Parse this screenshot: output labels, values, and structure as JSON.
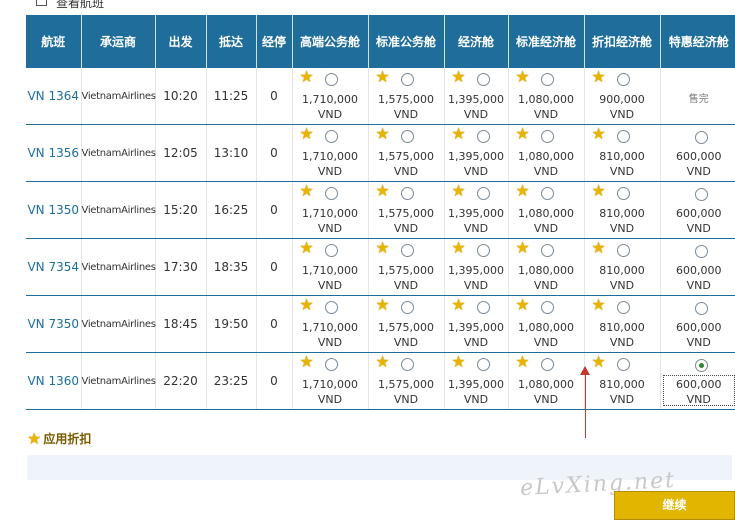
{
  "top_strip": {
    "label": "查看航班"
  },
  "columns": [
    "航班",
    "承运商",
    "出发",
    "抵达",
    "经停",
    "高端公务舱",
    "标准公务舱",
    "经济舱",
    "标准经济舱",
    "折扣经济舱",
    "特惠经济舱"
  ],
  "currency": "VND",
  "flights": [
    {
      "flight": "VN 1364",
      "carrier": "VietnamAirlines",
      "depart": "10:20",
      "arrive": "11:25",
      "stops": "0",
      "fares": [
        {
          "price": "1,710,000",
          "star": true
        },
        {
          "price": "1,575,000",
          "star": true
        },
        {
          "price": "1,395,000",
          "star": true
        },
        {
          "price": "1,080,000",
          "star": true
        },
        {
          "price": "900,000",
          "star": true
        },
        {
          "soldout": "售完"
        }
      ]
    },
    {
      "flight": "VN 1356",
      "carrier": "VietnamAirlines",
      "depart": "12:05",
      "arrive": "13:10",
      "stops": "0",
      "fares": [
        {
          "price": "1,710,000",
          "star": true
        },
        {
          "price": "1,575,000",
          "star": true
        },
        {
          "price": "1,395,000",
          "star": true
        },
        {
          "price": "1,080,000",
          "star": true
        },
        {
          "price": "810,000",
          "star": true
        },
        {
          "price": "600,000",
          "star": false
        }
      ]
    },
    {
      "flight": "VN 1350",
      "carrier": "VietnamAirlines",
      "depart": "15:20",
      "arrive": "16:25",
      "stops": "0",
      "fares": [
        {
          "price": "1,710,000",
          "star": true
        },
        {
          "price": "1,575,000",
          "star": true
        },
        {
          "price": "1,395,000",
          "star": true
        },
        {
          "price": "1,080,000",
          "star": true
        },
        {
          "price": "810,000",
          "star": true
        },
        {
          "price": "600,000",
          "star": false
        }
      ]
    },
    {
      "flight": "VN 7354",
      "carrier": "VietnamAirlines",
      "depart": "17:30",
      "arrive": "18:35",
      "stops": "0",
      "fares": [
        {
          "price": "1,710,000",
          "star": true
        },
        {
          "price": "1,575,000",
          "star": true
        },
        {
          "price": "1,395,000",
          "star": true
        },
        {
          "price": "1,080,000",
          "star": true
        },
        {
          "price": "810,000",
          "star": true
        },
        {
          "price": "600,000",
          "star": false
        }
      ]
    },
    {
      "flight": "VN 7350",
      "carrier": "VietnamAirlines",
      "depart": "18:45",
      "arrive": "19:50",
      "stops": "0",
      "fares": [
        {
          "price": "1,710,000",
          "star": true
        },
        {
          "price": "1,575,000",
          "star": true
        },
        {
          "price": "1,395,000",
          "star": true
        },
        {
          "price": "1,080,000",
          "star": true
        },
        {
          "price": "810,000",
          "star": true
        },
        {
          "price": "600,000",
          "star": false
        }
      ]
    },
    {
      "flight": "VN 1360",
      "carrier": "VietnamAirlines",
      "depart": "22:20",
      "arrive": "23:25",
      "stops": "0",
      "fares": [
        {
          "price": "1,710,000",
          "star": true
        },
        {
          "price": "1,575,000",
          "star": true
        },
        {
          "price": "1,395,000",
          "star": true
        },
        {
          "price": "1,080,000",
          "star": true
        },
        {
          "price": "810,000",
          "star": true
        },
        {
          "price": "600,000",
          "star": false,
          "selected": true
        }
      ]
    }
  ],
  "apply_discount": {
    "label": "应用折扣",
    "icon": "star-icon"
  },
  "watermark": "eLvXing.net",
  "continue_label": "继续",
  "colors": {
    "header": "#1e6d9a",
    "star": "#e8b400",
    "button": "#e2b600",
    "arrow": "#c0392b"
  }
}
